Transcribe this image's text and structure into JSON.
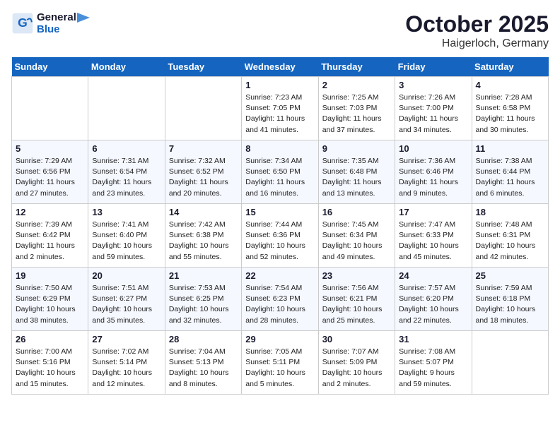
{
  "header": {
    "logo_line1": "General",
    "logo_line2": "Blue",
    "month": "October 2025",
    "location": "Haigerloch, Germany"
  },
  "weekdays": [
    "Sunday",
    "Monday",
    "Tuesday",
    "Wednesday",
    "Thursday",
    "Friday",
    "Saturday"
  ],
  "weeks": [
    [
      {
        "day": "",
        "info": ""
      },
      {
        "day": "",
        "info": ""
      },
      {
        "day": "",
        "info": ""
      },
      {
        "day": "1",
        "info": "Sunrise: 7:23 AM\nSunset: 7:05 PM\nDaylight: 11 hours and 41 minutes."
      },
      {
        "day": "2",
        "info": "Sunrise: 7:25 AM\nSunset: 7:03 PM\nDaylight: 11 hours and 37 minutes."
      },
      {
        "day": "3",
        "info": "Sunrise: 7:26 AM\nSunset: 7:00 PM\nDaylight: 11 hours and 34 minutes."
      },
      {
        "day": "4",
        "info": "Sunrise: 7:28 AM\nSunset: 6:58 PM\nDaylight: 11 hours and 30 minutes."
      }
    ],
    [
      {
        "day": "5",
        "info": "Sunrise: 7:29 AM\nSunset: 6:56 PM\nDaylight: 11 hours and 27 minutes."
      },
      {
        "day": "6",
        "info": "Sunrise: 7:31 AM\nSunset: 6:54 PM\nDaylight: 11 hours and 23 minutes."
      },
      {
        "day": "7",
        "info": "Sunrise: 7:32 AM\nSunset: 6:52 PM\nDaylight: 11 hours and 20 minutes."
      },
      {
        "day": "8",
        "info": "Sunrise: 7:34 AM\nSunset: 6:50 PM\nDaylight: 11 hours and 16 minutes."
      },
      {
        "day": "9",
        "info": "Sunrise: 7:35 AM\nSunset: 6:48 PM\nDaylight: 11 hours and 13 minutes."
      },
      {
        "day": "10",
        "info": "Sunrise: 7:36 AM\nSunset: 6:46 PM\nDaylight: 11 hours and 9 minutes."
      },
      {
        "day": "11",
        "info": "Sunrise: 7:38 AM\nSunset: 6:44 PM\nDaylight: 11 hours and 6 minutes."
      }
    ],
    [
      {
        "day": "12",
        "info": "Sunrise: 7:39 AM\nSunset: 6:42 PM\nDaylight: 11 hours and 2 minutes."
      },
      {
        "day": "13",
        "info": "Sunrise: 7:41 AM\nSunset: 6:40 PM\nDaylight: 10 hours and 59 minutes."
      },
      {
        "day": "14",
        "info": "Sunrise: 7:42 AM\nSunset: 6:38 PM\nDaylight: 10 hours and 55 minutes."
      },
      {
        "day": "15",
        "info": "Sunrise: 7:44 AM\nSunset: 6:36 PM\nDaylight: 10 hours and 52 minutes."
      },
      {
        "day": "16",
        "info": "Sunrise: 7:45 AM\nSunset: 6:34 PM\nDaylight: 10 hours and 49 minutes."
      },
      {
        "day": "17",
        "info": "Sunrise: 7:47 AM\nSunset: 6:33 PM\nDaylight: 10 hours and 45 minutes."
      },
      {
        "day": "18",
        "info": "Sunrise: 7:48 AM\nSunset: 6:31 PM\nDaylight: 10 hours and 42 minutes."
      }
    ],
    [
      {
        "day": "19",
        "info": "Sunrise: 7:50 AM\nSunset: 6:29 PM\nDaylight: 10 hours and 38 minutes."
      },
      {
        "day": "20",
        "info": "Sunrise: 7:51 AM\nSunset: 6:27 PM\nDaylight: 10 hours and 35 minutes."
      },
      {
        "day": "21",
        "info": "Sunrise: 7:53 AM\nSunset: 6:25 PM\nDaylight: 10 hours and 32 minutes."
      },
      {
        "day": "22",
        "info": "Sunrise: 7:54 AM\nSunset: 6:23 PM\nDaylight: 10 hours and 28 minutes."
      },
      {
        "day": "23",
        "info": "Sunrise: 7:56 AM\nSunset: 6:21 PM\nDaylight: 10 hours and 25 minutes."
      },
      {
        "day": "24",
        "info": "Sunrise: 7:57 AM\nSunset: 6:20 PM\nDaylight: 10 hours and 22 minutes."
      },
      {
        "day": "25",
        "info": "Sunrise: 7:59 AM\nSunset: 6:18 PM\nDaylight: 10 hours and 18 minutes."
      }
    ],
    [
      {
        "day": "26",
        "info": "Sunrise: 7:00 AM\nSunset: 5:16 PM\nDaylight: 10 hours and 15 minutes."
      },
      {
        "day": "27",
        "info": "Sunrise: 7:02 AM\nSunset: 5:14 PM\nDaylight: 10 hours and 12 minutes."
      },
      {
        "day": "28",
        "info": "Sunrise: 7:04 AM\nSunset: 5:13 PM\nDaylight: 10 hours and 8 minutes."
      },
      {
        "day": "29",
        "info": "Sunrise: 7:05 AM\nSunset: 5:11 PM\nDaylight: 10 hours and 5 minutes."
      },
      {
        "day": "30",
        "info": "Sunrise: 7:07 AM\nSunset: 5:09 PM\nDaylight: 10 hours and 2 minutes."
      },
      {
        "day": "31",
        "info": "Sunrise: 7:08 AM\nSunset: 5:07 PM\nDaylight: 9 hours and 59 minutes."
      },
      {
        "day": "",
        "info": ""
      }
    ]
  ]
}
